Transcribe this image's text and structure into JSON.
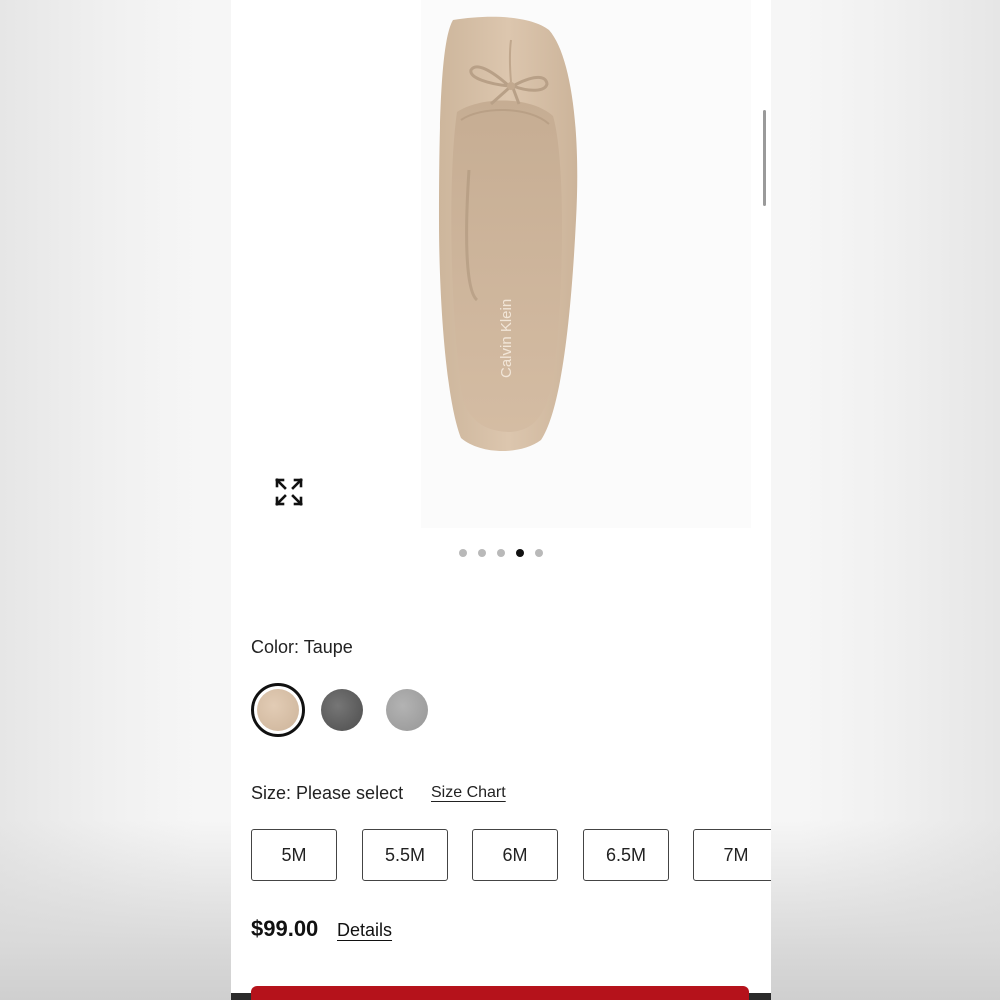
{
  "product": {
    "brand_mark": "Calvin Klein",
    "image_dots": {
      "count": 5,
      "active_index": 3
    }
  },
  "color": {
    "label": "Color: Taupe",
    "swatches": [
      {
        "name": "taupe",
        "hex": "#d8c0a7",
        "selected": true
      },
      {
        "name": "grey-textured",
        "hex": "#5e5e5e",
        "selected": false
      },
      {
        "name": "grey",
        "hex": "#a3a3a3",
        "selected": false
      }
    ]
  },
  "size": {
    "label": "Size: Please select",
    "chart_link": "Size Chart",
    "options": [
      "5M",
      "5.5M",
      "6M",
      "6.5M",
      "7M"
    ]
  },
  "price": {
    "value": "$99.00",
    "details_link": "Details"
  },
  "colors": {
    "cta": "#b5121b",
    "shoe": "#d9c3ab"
  },
  "icons": {
    "expand": "expand-arrows-icon"
  }
}
